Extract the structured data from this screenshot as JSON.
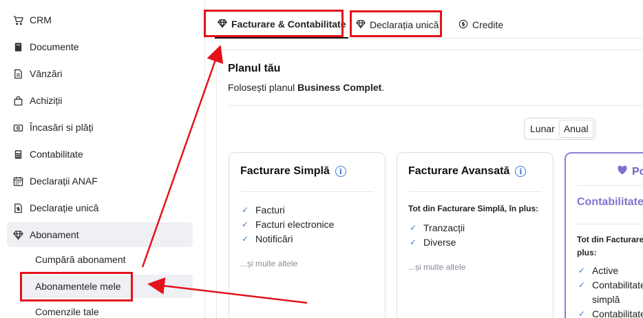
{
  "sidebar": {
    "items": [
      {
        "label": "CRM",
        "icon": "cart-icon"
      },
      {
        "label": "Documente",
        "icon": "document-icon"
      },
      {
        "label": "Vânzări",
        "icon": "invoice-icon"
      },
      {
        "label": "Achiziții",
        "icon": "bag-icon"
      },
      {
        "label": "Încasări si plăți",
        "icon": "cash-icon"
      },
      {
        "label": "Contabilitate",
        "icon": "calculator-icon"
      },
      {
        "label": "Declarații ANAF",
        "icon": "calendar-icon"
      },
      {
        "label": "Declarație unică",
        "icon": "file-dollar-icon"
      },
      {
        "label": "Abonament",
        "icon": "diamond-icon"
      }
    ],
    "subitems": [
      {
        "label": "Cumpără abonament"
      },
      {
        "label": "Abonamentele mele"
      },
      {
        "label": "Comenzile tale"
      }
    ]
  },
  "tabs": [
    {
      "label": "Facturare & Contabilitate",
      "icon": "diamond-icon"
    },
    {
      "label": "Declarația unică",
      "icon": "diamond-icon"
    },
    {
      "label": "Credite",
      "icon": "coin-icon"
    }
  ],
  "plan": {
    "title": "Planul tău",
    "desc_prefix": "Folosești planul ",
    "plan_name": "Business Complet",
    "desc_suffix": "."
  },
  "billing_toggle": {
    "monthly": "Lunar",
    "yearly": "Anual"
  },
  "cards": [
    {
      "title": "Facturare Simplă",
      "features": [
        "Facturi",
        "Facturi electronice",
        "Notificări"
      ],
      "more": "...și multe altele"
    },
    {
      "title": "Facturare Avansată",
      "plus_note": "Tot din Facturare Simplă, în plus:",
      "features": [
        "Tranzacții",
        "Diverse"
      ],
      "more": "...și multe altele"
    },
    {
      "head": "Po",
      "title": "Contabilitate",
      "plus_note_line1": "Tot din Facturare A",
      "plus_note_line2": "plus:",
      "features": [
        "Active",
        "Contabilitate",
        "simplă",
        "Contabilitate"
      ]
    }
  ],
  "colors": {
    "accent": "#3a7bd5",
    "highlight": "#8b7fd6",
    "annotation": "#e3121b"
  }
}
